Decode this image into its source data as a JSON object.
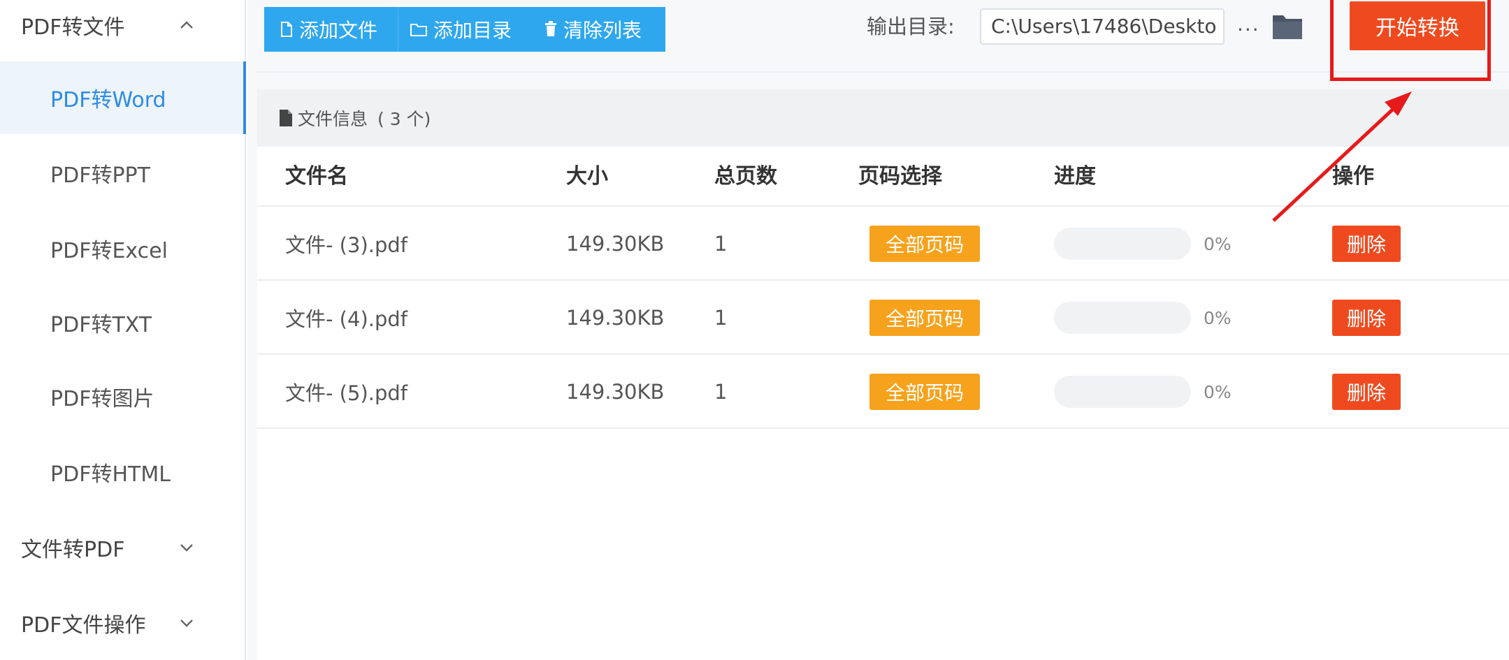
{
  "sidebar": {
    "group_pdf_to_file": "PDF转文件",
    "items": [
      {
        "label": "PDF转Word",
        "active": true
      },
      {
        "label": "PDF转PPT",
        "active": false
      },
      {
        "label": "PDF转Excel",
        "active": false
      },
      {
        "label": "PDF转TXT",
        "active": false
      },
      {
        "label": "PDF转图片",
        "active": false
      },
      {
        "label": "PDF转HTML",
        "active": false
      }
    ],
    "group_file_to_pdf": "文件转PDF",
    "group_pdf_ops": "PDF文件操作"
  },
  "toolbar": {
    "add_file": "添加文件",
    "add_folder": "添加目录",
    "clear_list": "清除列表",
    "output_label": "输出目录:",
    "output_path": "C:\\Users\\17486\\Deskto",
    "more": "···",
    "start": "开始转换"
  },
  "panel": {
    "title": "文件信息",
    "count": "( 3 个)"
  },
  "table": {
    "headers": {
      "name": "文件名",
      "size": "大小",
      "pages": "总页数",
      "page_select": "页码选择",
      "progress": "进度",
      "action": "操作"
    },
    "rows": [
      {
        "name": "文件- (3).pdf",
        "size": "149.30KB",
        "pages": "1",
        "page_select": "全部页码",
        "progress_pct": 0,
        "progress": "0%",
        "action": "删除"
      },
      {
        "name": "文件- (4).pdf",
        "size": "149.30KB",
        "pages": "1",
        "page_select": "全部页码",
        "progress_pct": 0,
        "progress": "0%",
        "action": "删除"
      },
      {
        "name": "文件- (5).pdf",
        "size": "149.30KB",
        "pages": "1",
        "page_select": "全部页码",
        "progress_pct": 0,
        "progress": "0%",
        "action": "删除"
      }
    ]
  },
  "colors": {
    "accent_blue": "#2ea7ef",
    "start_red": "#ef4a1f",
    "badge_orange": "#f7a21c",
    "annotation_red": "#e51b1b"
  }
}
